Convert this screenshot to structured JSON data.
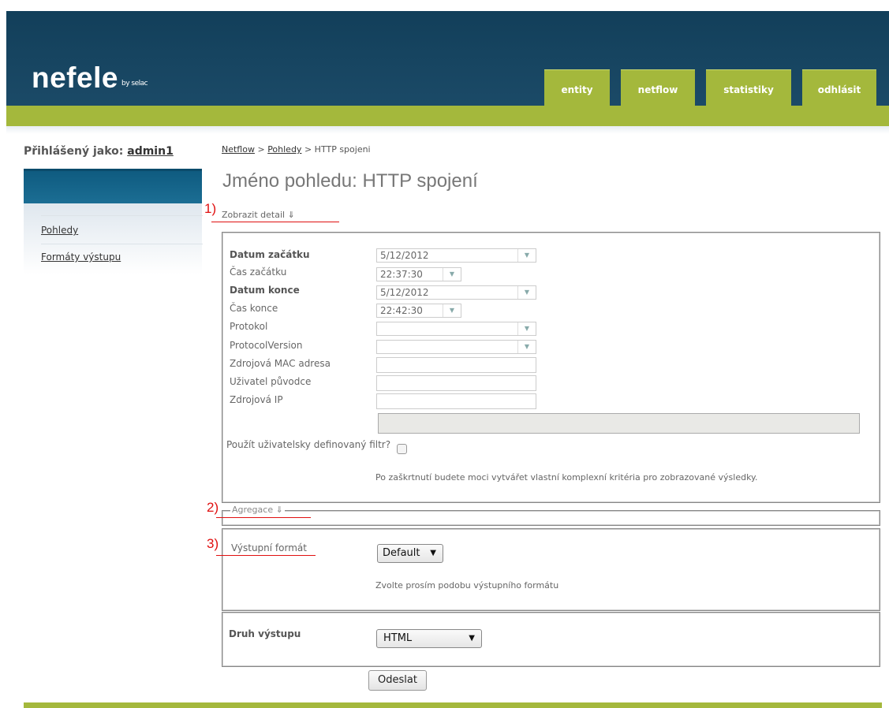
{
  "header": {
    "logo": "nefele",
    "logo_by": "by selac",
    "nav": [
      "entity",
      "netflow",
      "statistiky",
      "odhlásit"
    ]
  },
  "sidebar": {
    "logged_label": "Přihlášený jako:",
    "user": "admin1",
    "items": [
      "Pohledy",
      "Formáty výstupu"
    ]
  },
  "breadcrumb": {
    "a": "Netflow",
    "sep1": " > ",
    "b": "Pohledy",
    "sep2": " > ",
    "c": "HTTP spojeni"
  },
  "title": "Jméno pohledu: HTTP spojení",
  "annotations": [
    "1)",
    "2)",
    "3)"
  ],
  "detail": {
    "legend": "Zobrazit detail ⇓",
    "fields": {
      "start_date_label": "Datum začátku",
      "start_date": "5/12/2012",
      "start_time_label": "Čas začátku",
      "start_time": "22:37:30",
      "end_date_label": "Datum konce",
      "end_date": "5/12/2012",
      "end_time_label": "Čas konce",
      "end_time": "22:42:30",
      "protocol_label": "Protokol",
      "protocol_version_label": "ProtocolVersion",
      "mac_label": "Zdrojová MAC adresa",
      "user_label": "Uživatel původce",
      "ip_label": "Zdrojová IP"
    },
    "custom_filter_label": "Použít uživatelsky definovaný filtr?",
    "custom_filter_help": "Po zaškrtnutí budete moci vytvářet vlastní komplexní kritéria pro zobrazované výsledky."
  },
  "aggregation": {
    "legend": "Agregace ⇓"
  },
  "output_format": {
    "label": "Výstupní formát",
    "value": "Default",
    "help": "Zvolte prosím podobu výstupního formátu"
  },
  "output_type": {
    "label": "Druh výstupu",
    "value": "HTML"
  },
  "submit": "Odeslat",
  "icons": {
    "dropdown": "▼",
    "arrow": "▼"
  }
}
